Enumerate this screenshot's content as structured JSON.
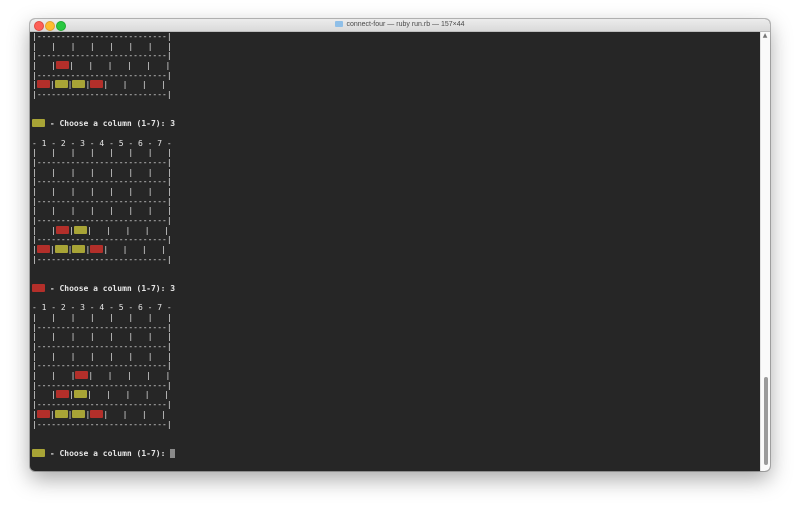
{
  "window": {
    "title": "connect-four — ruby run.rb — 157×44"
  },
  "colors": {
    "red_disc": "#b32f2a",
    "yellow_disc": "#a8a436",
    "terminal_bg": "#262626",
    "text": "#e6e6e6"
  },
  "terminal": {
    "lines": [
      {
        "kind": "border",
        "text": "|---------------------------|"
      },
      {
        "kind": "cells",
        "cells": [
          "",
          "",
          "",
          "",
          "",
          "",
          ""
        ]
      },
      {
        "kind": "border",
        "text": "|---------------------------|"
      },
      {
        "kind": "cells",
        "cells": [
          "",
          "red",
          "",
          "",
          "",
          "",
          ""
        ]
      },
      {
        "kind": "border",
        "text": "|---------------------------|"
      },
      {
        "kind": "cells",
        "cells": [
          "red",
          "yellow",
          "yellow",
          "red",
          "",
          "",
          ""
        ]
      },
      {
        "kind": "border",
        "text": "|---------------------------|"
      },
      {
        "kind": "blank"
      },
      {
        "kind": "blank"
      },
      {
        "kind": "prompt",
        "player": "yellow",
        "text": " - Choose a column (1-7): 3"
      },
      {
        "kind": "blank"
      },
      {
        "kind": "header",
        "text": "- 1 - 2 - 3 - 4 - 5 - 6 - 7 -"
      },
      {
        "kind": "cells",
        "cells": [
          "",
          "",
          "",
          "",
          "",
          "",
          ""
        ]
      },
      {
        "kind": "border",
        "text": "|---------------------------|"
      },
      {
        "kind": "cells",
        "cells": [
          "",
          "",
          "",
          "",
          "",
          "",
          ""
        ]
      },
      {
        "kind": "border",
        "text": "|---------------------------|"
      },
      {
        "kind": "cells",
        "cells": [
          "",
          "",
          "",
          "",
          "",
          "",
          ""
        ]
      },
      {
        "kind": "border",
        "text": "|---------------------------|"
      },
      {
        "kind": "cells",
        "cells": [
          "",
          "",
          "",
          "",
          "",
          "",
          ""
        ]
      },
      {
        "kind": "border",
        "text": "|---------------------------|"
      },
      {
        "kind": "cells",
        "cells": [
          "",
          "red",
          "yellow",
          "",
          "",
          "",
          ""
        ]
      },
      {
        "kind": "border",
        "text": "|---------------------------|"
      },
      {
        "kind": "cells",
        "cells": [
          "red",
          "yellow",
          "yellow",
          "red",
          "",
          "",
          ""
        ]
      },
      {
        "kind": "border",
        "text": "|---------------------------|"
      },
      {
        "kind": "blank"
      },
      {
        "kind": "blank"
      },
      {
        "kind": "prompt",
        "player": "red",
        "text": " - Choose a column (1-7): 3"
      },
      {
        "kind": "blank"
      },
      {
        "kind": "header",
        "text": "- 1 - 2 - 3 - 4 - 5 - 6 - 7 -"
      },
      {
        "kind": "cells",
        "cells": [
          "",
          "",
          "",
          "",
          "",
          "",
          ""
        ]
      },
      {
        "kind": "border",
        "text": "|---------------------------|"
      },
      {
        "kind": "cells",
        "cells": [
          "",
          "",
          "",
          "",
          "",
          "",
          ""
        ]
      },
      {
        "kind": "border",
        "text": "|---------------------------|"
      },
      {
        "kind": "cells",
        "cells": [
          "",
          "",
          "",
          "",
          "",
          "",
          ""
        ]
      },
      {
        "kind": "border",
        "text": "|---------------------------|"
      },
      {
        "kind": "cells",
        "cells": [
          "",
          "",
          "red",
          "",
          "",
          "",
          ""
        ]
      },
      {
        "kind": "border",
        "text": "|---------------------------|"
      },
      {
        "kind": "cells",
        "cells": [
          "",
          "red",
          "yellow",
          "",
          "",
          "",
          ""
        ]
      },
      {
        "kind": "border",
        "text": "|---------------------------|"
      },
      {
        "kind": "cells",
        "cells": [
          "red",
          "yellow",
          "yellow",
          "red",
          "",
          "",
          ""
        ]
      },
      {
        "kind": "border",
        "text": "|---------------------------|"
      },
      {
        "kind": "blank"
      },
      {
        "kind": "blank"
      },
      {
        "kind": "prompt",
        "player": "yellow",
        "text": " - Choose a column (1-7): ",
        "cursor": true
      }
    ]
  }
}
